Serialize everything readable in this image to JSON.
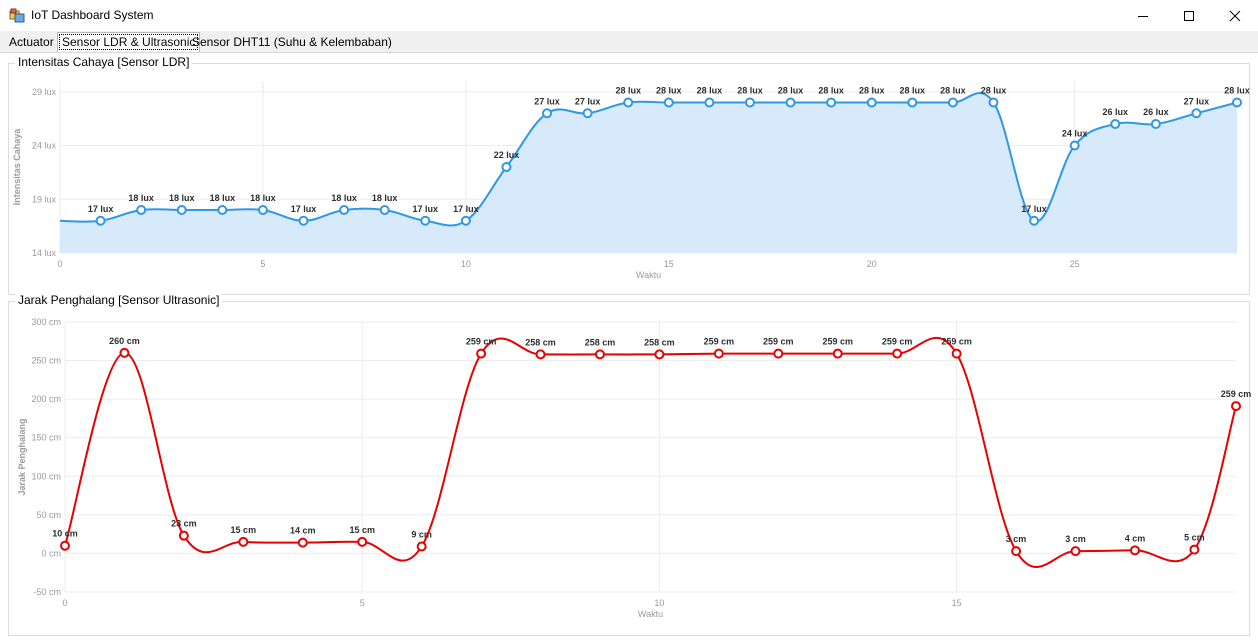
{
  "window": {
    "title": "IoT Dashboard System",
    "icon": "app-icon",
    "controls": [
      "minimize-icon",
      "maximize-icon",
      "close-icon"
    ]
  },
  "tabs": [
    {
      "label": "Actuator",
      "active": false
    },
    {
      "label": "Sensor LDR & Ultrasonic",
      "active": true
    },
    {
      "label": "Sensor DHT11 (Suhu & Kelembaban)",
      "active": false
    }
  ],
  "groups": {
    "ldr": {
      "title": "Intensitas Cahaya [Sensor LDR]"
    },
    "ultrasonic": {
      "title": "Jarak Penghalang [Sensor Ultrasonic]"
    }
  },
  "chart_data": [
    {
      "type": "area",
      "xlabel": "Waktu",
      "ylabel": "Intensitas Cahaya",
      "xlim": [
        0,
        29
      ],
      "ylim": [
        14,
        30
      ],
      "xticks": [
        0,
        5,
        10,
        15,
        20,
        25
      ],
      "yticks": [
        14,
        19,
        24,
        29
      ],
      "ytick_suffix": " lux",
      "grid": true,
      "color": "#2f97e4",
      "fill": "#d6eafb",
      "x": [
        0,
        1,
        2,
        3,
        4,
        5,
        6,
        7,
        8,
        9,
        10,
        11,
        12,
        13,
        14,
        15,
        16,
        17,
        18,
        19,
        20,
        21,
        22,
        23,
        24,
        25,
        26,
        27,
        28,
        29
      ],
      "y": [
        17,
        17,
        18,
        18,
        18,
        18,
        17,
        18,
        18,
        17,
        17,
        22,
        27,
        27,
        28,
        28,
        28,
        28,
        28,
        28,
        28,
        28,
        28,
        28,
        17,
        24,
        26,
        26,
        27,
        28
      ],
      "labels": [
        "",
        "17 lux",
        "18 lux",
        "18 lux",
        "18 lux",
        "18 lux",
        "17 lux",
        "18 lux",
        "18 lux",
        "17 lux",
        "17 lux",
        "22 lux",
        "27 lux",
        "27 lux",
        "28 lux",
        "28 lux",
        "28 lux",
        "28 lux",
        "28 lux",
        "28 lux",
        "28 lux",
        "28 lux",
        "28 lux",
        "28 lux",
        "17 lux",
        "24 lux",
        "26 lux",
        "26 lux",
        "27 lux",
        "28 lux"
      ],
      "markers_from": 1
    },
    {
      "type": "line",
      "xlabel": "Waktu",
      "ylabel": "Jarak Penghalang",
      "xlim": [
        0,
        19.7
      ],
      "ylim": [
        -50,
        300
      ],
      "xticks": [
        0,
        5,
        10,
        15
      ],
      "yticks": [
        -50,
        0,
        50,
        100,
        150,
        200,
        250,
        300
      ],
      "ytick_suffix": " cm",
      "grid": true,
      "color": "#e60000",
      "x": [
        0,
        1,
        2,
        3,
        4,
        5,
        6,
        7,
        8,
        9,
        10,
        11,
        12,
        13,
        14,
        15,
        16,
        17,
        18,
        19,
        19.7
      ],
      "y": [
        10,
        260,
        23,
        15,
        14,
        15,
        9,
        259,
        258,
        258,
        258,
        259,
        259,
        259,
        259,
        259,
        3,
        3,
        4,
        5,
        191
      ],
      "labels": [
        "10 cm",
        "260 cm",
        "23 cm",
        "15 cm",
        "14 cm",
        "15 cm",
        "9 cm",
        "259 cm",
        "258 cm",
        "258 cm",
        "258 cm",
        "259 cm",
        "259 cm",
        "259 cm",
        "259 cm",
        "259 cm",
        "3 cm",
        "3 cm",
        "4 cm",
        "5 cm",
        "259 cm"
      ],
      "markers_from": 0
    }
  ]
}
